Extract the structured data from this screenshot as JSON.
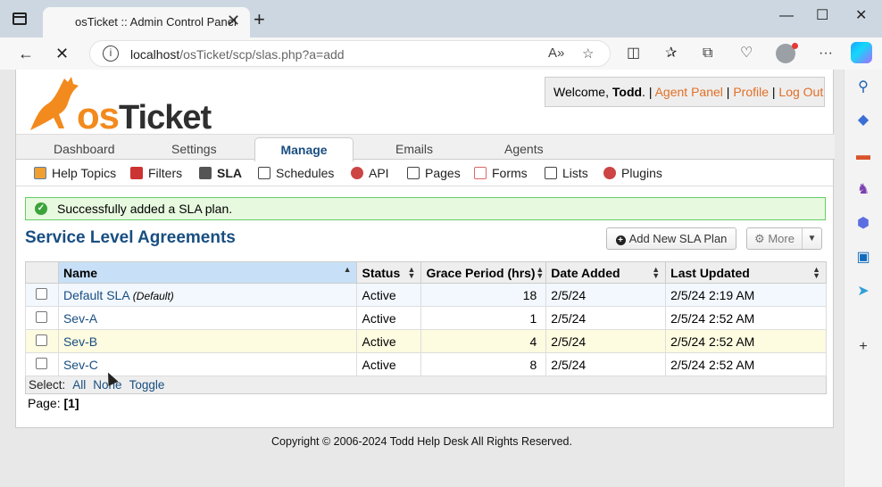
{
  "browser": {
    "tab_title": "osTicket :: Admin Control Panel",
    "url_host": "localhost",
    "url_path": "/osTicket/scp/slas.php?a=add"
  },
  "header": {
    "logo_text_o": "os",
    "logo_text_rest": "Ticket",
    "welcome_prefix": "Welcome,",
    "user_name": "Todd",
    "period": ".",
    "sep": "|",
    "agent_panel": "Agent Panel",
    "profile": "Profile",
    "logout": "Log Out"
  },
  "main_nav": {
    "dashboard": "Dashboard",
    "settings": "Settings",
    "manage": "Manage",
    "emails": "Emails",
    "agents": "Agents"
  },
  "sub_nav": {
    "help_topics": "Help Topics",
    "filters": "Filters",
    "sla": "SLA",
    "schedules": "Schedules",
    "api": "API",
    "pages": "Pages",
    "forms": "Forms",
    "lists": "Lists",
    "plugins": "Plugins"
  },
  "notice": "Successfully added a SLA plan.",
  "page_title": "Service Level Agreements",
  "buttons": {
    "add": "Add New SLA Plan",
    "more": "More"
  },
  "table": {
    "headers": {
      "name": "Name",
      "status": "Status",
      "grace": "Grace Period (hrs)",
      "added": "Date Added",
      "updated": "Last Updated"
    },
    "rows": [
      {
        "name": "Default SLA",
        "tag": "(Default)",
        "status": "Active",
        "grace": "18",
        "added": "2/5/24",
        "updated": "2/5/24 2:19 AM"
      },
      {
        "name": "Sev-A",
        "tag": "",
        "status": "Active",
        "grace": "1",
        "added": "2/5/24",
        "updated": "2/5/24 2:52 AM"
      },
      {
        "name": "Sev-B",
        "tag": "",
        "status": "Active",
        "grace": "4",
        "added": "2/5/24",
        "updated": "2/5/24 2:52 AM"
      },
      {
        "name": "Sev-C",
        "tag": "",
        "status": "Active",
        "grace": "8",
        "added": "2/5/24",
        "updated": "2/5/24 2:52 AM"
      }
    ],
    "select_label": "Select:",
    "select_all": "All",
    "select_none": "None",
    "select_toggle": "Toggle"
  },
  "pager": {
    "label": "Page:",
    "current": "[1]"
  },
  "footer": "Copyright © 2006-2024 Todd Help Desk All Rights Reserved.",
  "colors": {
    "brand_orange": "#e26f26",
    "heading_blue": "#184e81",
    "success_green": "#66cc66"
  }
}
